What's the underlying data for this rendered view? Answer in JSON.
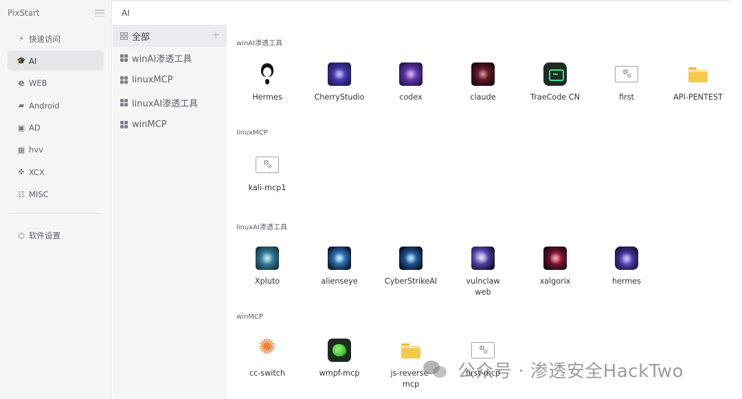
{
  "app": {
    "title": "PixStart"
  },
  "breadcrumb": "AI",
  "sidebar": {
    "items": [
      {
        "label": "快速访问",
        "icon": "lightning-icon",
        "active": false
      },
      {
        "label": "AI",
        "icon": "graduation-cap-icon",
        "active": true
      },
      {
        "label": "WEB",
        "icon": "internet-explorer-icon",
        "active": false
      },
      {
        "label": "Android",
        "icon": "android-icon",
        "active": false
      },
      {
        "label": "AD",
        "icon": "terminal-window-icon",
        "active": false
      },
      {
        "label": "hvv",
        "icon": "grid-icon",
        "active": false
      },
      {
        "label": "XCX",
        "icon": "gamepad-icon",
        "active": false
      },
      {
        "label": "MISC",
        "icon": "list-icon",
        "active": false
      }
    ],
    "settings_label": "软件设置"
  },
  "categories": [
    {
      "label": "全部",
      "active": true
    },
    {
      "label": "winAI渗透工具",
      "active": false
    },
    {
      "label": "linuxMCP",
      "active": false
    },
    {
      "label": "linuxAI渗透工具",
      "active": false
    },
    {
      "label": "winMCP",
      "active": false
    }
  ],
  "sections": [
    {
      "title": "winAI渗透工具",
      "apps": [
        {
          "label": "Hermes",
          "icon": "hermes-portrait-icon"
        },
        {
          "label": "CherryStudio",
          "icon": "cherry-studio-icon"
        },
        {
          "label": "codex",
          "icon": "codex-icon"
        },
        {
          "label": "claude",
          "icon": "claude-beast-icon"
        },
        {
          "label": "TraeCode CN",
          "icon": "trae-terminal-icon"
        },
        {
          "label": "first",
          "icon": "settings-file-icon"
        },
        {
          "label": "API-PENTEST",
          "icon": "folder-icon"
        }
      ]
    },
    {
      "title": "linuxMCP",
      "apps": [
        {
          "label": "kali-mcp1",
          "icon": "settings-file-icon"
        }
      ]
    },
    {
      "title": "linuxAI渗透工具",
      "apps": [
        {
          "label": "Xpluto",
          "icon": "xpluto-icon"
        },
        {
          "label": "alienseye",
          "icon": "alien-eye-icon"
        },
        {
          "label": "CyberStrikeAI",
          "icon": "cyberstrike-icon"
        },
        {
          "label": "vulnclaw web",
          "icon": "vulnclaw-icon"
        },
        {
          "label": "xalgorix",
          "icon": "xalgorix-icon"
        },
        {
          "label": "hermes",
          "icon": "hermes-cat-icon"
        }
      ]
    },
    {
      "title": "winMCP",
      "apps": [
        {
          "label": "cc-switch",
          "icon": "cc-switch-icon"
        },
        {
          "label": "wmpf-mcp",
          "icon": "wmpf-icon"
        },
        {
          "label": "js-reverse-mcp",
          "icon": "folder-icon"
        },
        {
          "label": "first-mcp",
          "icon": "settings-file-icon"
        }
      ]
    }
  ],
  "watermark": "公众号 · 渗透安全HackTwo"
}
